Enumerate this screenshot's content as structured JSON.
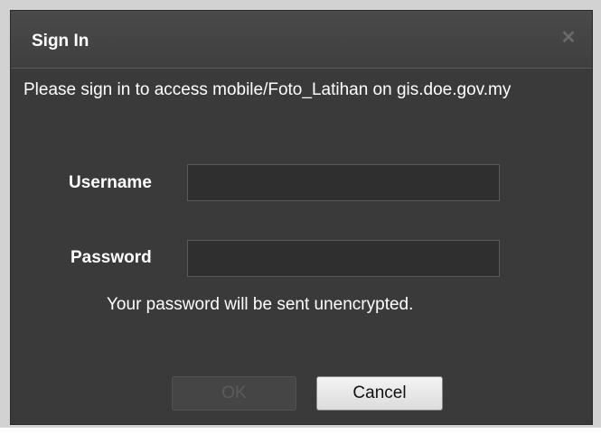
{
  "dialog": {
    "title": "Sign In",
    "close_icon": "close-icon",
    "message": "Please sign in to access mobile/Foto_Latihan on gis.doe.gov.my",
    "username": {
      "label": "Username",
      "value": "",
      "placeholder": ""
    },
    "password": {
      "label": "Password",
      "value": "",
      "placeholder": ""
    },
    "note": "Your password will be sent unencrypted.",
    "buttons": {
      "ok_label": "OK",
      "ok_enabled": false,
      "cancel_label": "Cancel"
    }
  }
}
